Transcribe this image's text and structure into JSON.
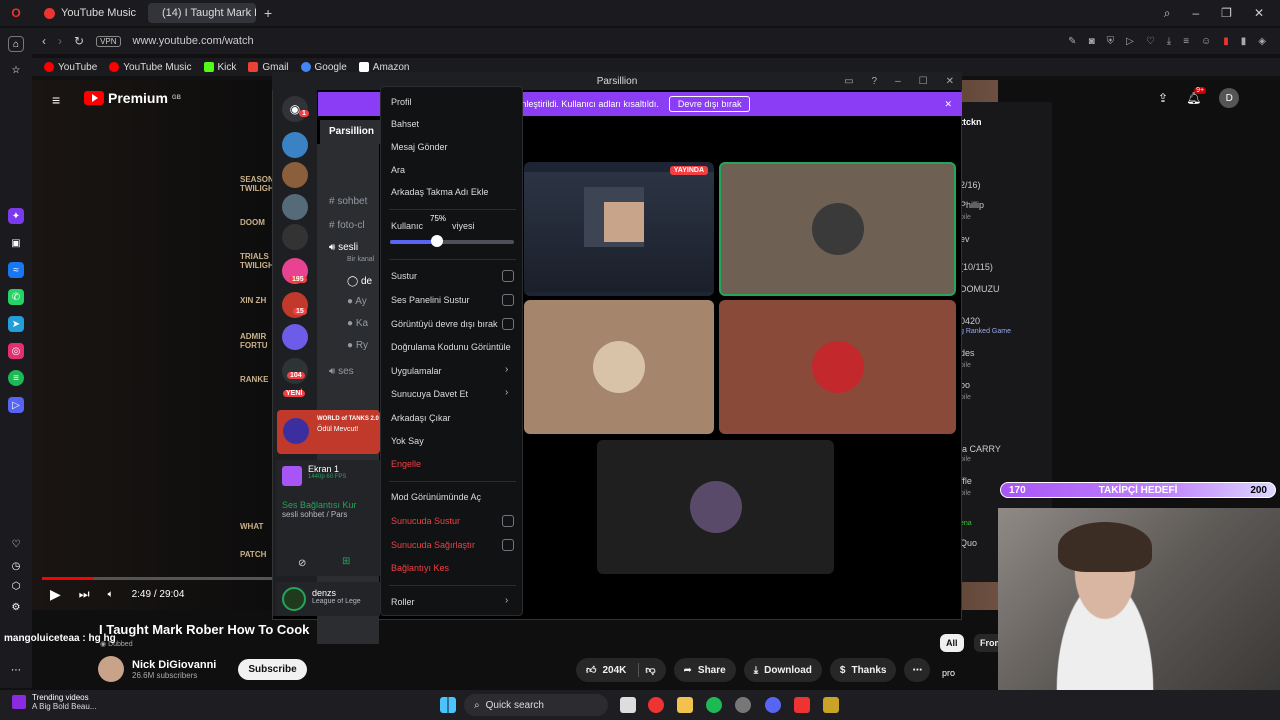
{
  "browser": {
    "tabs": [
      {
        "label": "YouTube Music"
      },
      {
        "label": "(14) I Taught Mark Rober H"
      }
    ],
    "url": "www.youtube.com/watch",
    "vpn_label": "VPN",
    "bookmarks": [
      "YouTube",
      "YouTube Music",
      "Kick",
      "Gmail",
      "Google",
      "Amazon"
    ]
  },
  "youtube": {
    "logo": "Premium",
    "logo_sup": "GB",
    "notif_badge": "9+",
    "account_initial": "D",
    "time": "2:49 / 29:04",
    "progress": 0.097,
    "title": "I Taught Mark Rober How To Cook",
    "dubbed": "Dubbed",
    "channel": "Nick DiGiovanni",
    "subscribers": "26.6M subscribers",
    "subscribe": "Subscribe",
    "likes": "204K",
    "share": "Share",
    "download": "Download",
    "thanks": "Thanks",
    "filter_all": "All",
    "filter_from": "From",
    "game_menu": [
      "SEASON TWILIGHT",
      "DOOM",
      "TRIALS TWILIGHT",
      "XIN ZH",
      "ADMIR FORTU",
      "RANKE",
      "WHAT",
      "PATCH"
    ]
  },
  "discord": {
    "window_title": "Parsillion",
    "banner_text": "odu etkinleştirildi. Kullanıcı adları kısaltıldı.",
    "banner_button": "Devre dışı bırak",
    "server_name": "Parsillion",
    "server_badges": [
      "1",
      "195",
      "15",
      "104"
    ],
    "new_label": "YENİ",
    "promo_title": "WORLD of TANKS 2.0",
    "promo_sub": "Ödül Mevcut!",
    "channels": [
      "sohbet",
      "foto-cl",
      "sesli",
      "Bir kanal",
      "de",
      "Ay",
      "Ka",
      "Ry",
      "ses"
    ],
    "screen_share": "Ekran 1",
    "screen_share_sub": "1440p 60 FPS",
    "voice_status": "Ses Bağlantısı Kur",
    "voice_channel": "sesli sohbet / Pars",
    "user_name": "denzs",
    "user_status": "League of Lege",
    "live_badge": "YAYINDA",
    "context_menu": {
      "items": [
        "Profil",
        "Bahset",
        "Mesaj Gönder",
        "Ara",
        "Arkadaş Takma Adı Ekle",
        "Kullanıcı Ses Seviyesi",
        "Sustur",
        "Ses Panelini Sustur",
        "Görüntüyü devre dışı bırak",
        "Doğrulama Kodunu Görüntüle",
        "Uygulamalar",
        "Sunucuya Davet Et",
        "Arkadaşı Çıkar",
        "Yok Say",
        "Engelle",
        "Mod Görünümünde Aç",
        "Sunucuda Sustur",
        "Sunucuda Sağırlaştır",
        "Bağlantıyı Kes",
        "Roller"
      ],
      "volume_label_visible": "Kullanıc",
      "volume_label_tail": "viyesi",
      "volume_tooltip": "75%",
      "volume_level": 0.375
    }
  },
  "twitch": {
    "chat_lines": [
      "ttckn",
      "2/16)",
      "Phillip",
      "bile",
      "ev",
      "(10/115)",
      "DOMUZU",
      "0420",
      "g Ranked Game",
      "des",
      "bile",
      "oo",
      "bile",
      "la CARRY",
      "bile",
      "ffle",
      "bile",
      "ena",
      "Quo"
    ],
    "goal_start": "170",
    "goal_label": "TAKİPÇİ HEDEFİ",
    "goal_end": "200",
    "overlay_chat": "mangoluiceteaa : hg hg",
    "pro_label": "pro"
  },
  "taskbar": {
    "trending_title": "Trending videos",
    "trending_sub": "A Big Bold Beau...",
    "search": "Quick search"
  },
  "colors": {
    "discord_accent": "#8a3df5",
    "discord_blurple": "#5865f2",
    "danger": "#f23f43",
    "youtube_red": "#ff0000",
    "goal_purple": "#a855f7"
  }
}
